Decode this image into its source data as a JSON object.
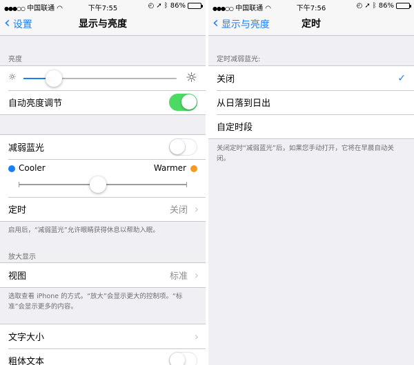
{
  "left": {
    "status": {
      "carrier": "中国联通",
      "time": "下午7:55",
      "battery": "86%",
      "battery_level": 0.86
    },
    "nav": {
      "back": "设置",
      "title": "显示与亮度"
    },
    "brightness": {
      "header": "亮度",
      "level": 0.2,
      "auto_label": "自动亮度调节",
      "auto_on": true
    },
    "night_shift": {
      "label": "减弱蓝光",
      "enabled": false,
      "cooler": "Cooler",
      "warmer": "Warmer",
      "cooler_color": "#1a7ef7",
      "warmer_color": "#f29b20",
      "temperature": 0.47,
      "schedule_label": "定时",
      "schedule_value": "关闭",
      "footer": "启用后，“减弱蓝光”允许眼睛获得休息以帮助入眠。"
    },
    "zoom": {
      "header": "放大显示",
      "view_label": "视图",
      "view_value": "标准",
      "footer": "选取查看 iPhone 的方式。“放大”会显示更大的控制项。“标准”会显示更多的内容。"
    },
    "text": {
      "size_label": "文字大小",
      "bold_label": "粗体文本",
      "bold_on": false
    }
  },
  "right": {
    "status": {
      "carrier": "中国联通",
      "time": "下午7:56",
      "battery": "86%",
      "battery_level": 0.86
    },
    "nav": {
      "back": "显示与亮度",
      "title": "定时"
    },
    "section_header": "定时减弱蓝光:",
    "options": [
      {
        "label": "关闭",
        "checked": true
      },
      {
        "label": "从日落到日出",
        "checked": false
      },
      {
        "label": "自定时段",
        "checked": false
      }
    ],
    "footer": "关闭定时“减弱蓝光”后，如果您手动打开，它将在早晨自动关闭。"
  },
  "icons": {
    "wifi": "wifi-icon",
    "alarm": "alarm-icon",
    "location": "location-arrow-icon",
    "bluetooth": "bluetooth-icon",
    "sun_small": "sun-small-icon",
    "sun_large": "sun-large-icon",
    "back": "chevron-left-icon",
    "disclosure": "chevron-right-icon",
    "check": "checkmark-icon"
  },
  "colors": {
    "accent": "#1a7ef7",
    "switch_on": "#4cd964",
    "background": "#efeff4"
  }
}
